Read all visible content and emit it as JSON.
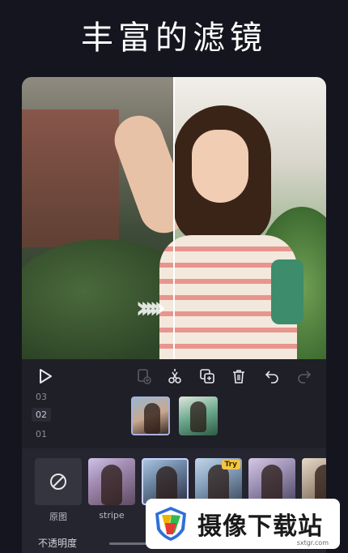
{
  "headline": "丰富的滤镜",
  "toolbar": {
    "play": "▷",
    "add_clip": "⊡",
    "cut": "✂",
    "copy": "⧉",
    "delete": "🗑",
    "undo": "↶",
    "redo": "↷"
  },
  "timeline": {
    "tracks": [
      "03",
      "02",
      "01"
    ]
  },
  "filters": [
    {
      "label": "原图"
    },
    {
      "label": "stripe"
    },
    {
      "label": ""
    },
    {
      "label": "",
      "badge": "Try"
    },
    {
      "label": ""
    },
    {
      "label": ""
    }
  ],
  "opacity_label": "不透明度",
  "watermark": {
    "text": "摄像下载站",
    "url": "sxtgr.com"
  },
  "colors": {
    "background": "#15151f",
    "panel": "#252530",
    "accent_badge": "#f5c542"
  }
}
